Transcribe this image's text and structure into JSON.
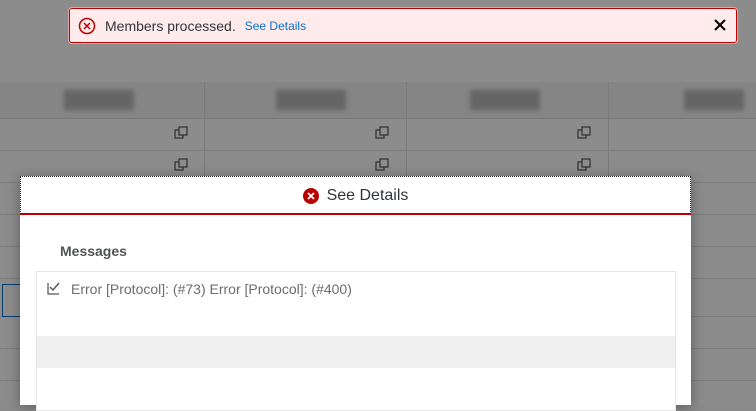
{
  "toast": {
    "message": "Members processed.",
    "link": "See Details"
  },
  "dialog": {
    "title": "See Details",
    "section_label": "Messages",
    "messages": [
      {
        "text": "Error [Protocol]: (#73) Error [Protocol]: (#400)"
      }
    ]
  },
  "colors": {
    "error_red": "#bb0000",
    "link_blue": "#0a6ed1",
    "toast_bg": "#ffebeb"
  }
}
